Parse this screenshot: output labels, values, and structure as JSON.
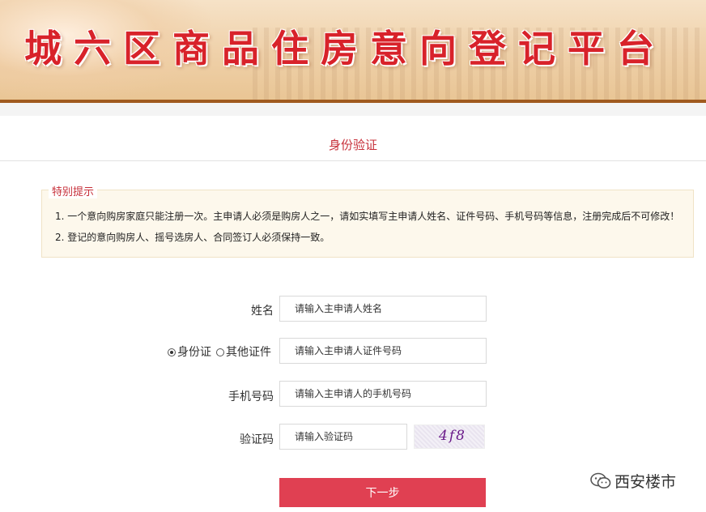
{
  "banner": {
    "title": "城六区商品住房意向登记平台"
  },
  "page": {
    "section_title": "身份验证"
  },
  "notice": {
    "legend": "特别提示",
    "lines": [
      "1. 一个意向购房家庭只能注册一次。主申请人必须是购房人之一，请如实填写主申请人姓名、证件号码、手机号码等信息，注册完成后不可修改！",
      "2. 登记的意向购房人、摇号选房人、合同签订人必须保持一致。"
    ]
  },
  "form": {
    "name_label": "姓名",
    "name_placeholder": "请输入主申请人姓名",
    "id_type_options": [
      {
        "label": "身份证",
        "selected": true
      },
      {
        "label": "其他证件",
        "selected": false
      }
    ],
    "id_placeholder": "请输入主申请人证件号码",
    "phone_label": "手机号码",
    "phone_placeholder": "请输入主申请人的手机号码",
    "captcha_label": "验证码",
    "captcha_placeholder": "请输入验证码",
    "captcha_text": "4f8",
    "next_button": "下一步"
  },
  "watermark": {
    "text": "西安楼市",
    "icon": "wechat-icon"
  },
  "colors": {
    "accent_red": "#c7303a",
    "button_red": "#e04052",
    "banner_title_red": "#d8222a",
    "notice_bg": "#fdf8ec"
  }
}
